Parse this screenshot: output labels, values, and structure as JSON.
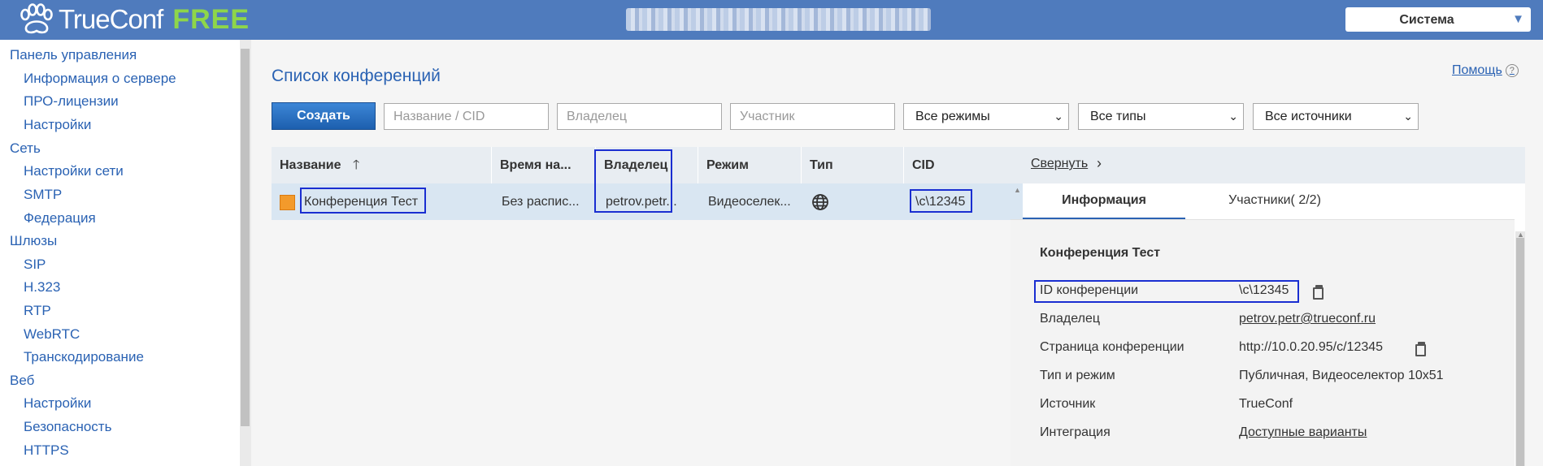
{
  "header": {
    "logo_text": "TrueConf",
    "logo_badge": "FREE",
    "system_select": "Система",
    "colors": {
      "bar": "#4f7bbd",
      "badge": "#8ed64a"
    }
  },
  "sidebar": {
    "items": [
      {
        "label": "Панель управления",
        "level": 0
      },
      {
        "label": "Информация о сервере",
        "level": 1
      },
      {
        "label": "ПРО-лицензии",
        "level": 1
      },
      {
        "label": "Настройки",
        "level": 1
      },
      {
        "label": "Сеть",
        "level": 0
      },
      {
        "label": "Настройки сети",
        "level": 1
      },
      {
        "label": "SMTP",
        "level": 1
      },
      {
        "label": "Федерация",
        "level": 1
      },
      {
        "label": "Шлюзы",
        "level": 0
      },
      {
        "label": "SIP",
        "level": 1
      },
      {
        "label": "H.323",
        "level": 1
      },
      {
        "label": "RTP",
        "level": 1
      },
      {
        "label": "WebRTC",
        "level": 1
      },
      {
        "label": "Транскодирование",
        "level": 1
      },
      {
        "label": "Веб",
        "level": 0
      },
      {
        "label": "Настройки",
        "level": 1
      },
      {
        "label": "Безопасность",
        "level": 1
      },
      {
        "label": "HTTPS",
        "level": 1
      }
    ]
  },
  "main": {
    "title": "Список конференций",
    "help": "Помощь",
    "help_icon": "question-circle-icon",
    "create_button": "Создать",
    "filters": {
      "name_placeholder": "Название / CID",
      "owner_placeholder": "Владелец",
      "participant_placeholder": "Участник",
      "modes": "Все режимы",
      "types": "Все типы",
      "sources": "Все источники"
    },
    "table": {
      "columns": [
        "Название",
        "Время на...",
        "Владелец",
        "Режим",
        "Тип",
        "CID"
      ],
      "sort_icon": "arrow-up-icon",
      "rows": [
        {
          "name": "Конференция Тест",
          "time": "Без распис...",
          "owner": "petrov.petr...",
          "mode": "Видеоселек...",
          "type_icon": "globe-icon",
          "cid": "\\c\\12345"
        }
      ]
    }
  },
  "panel": {
    "collapse": "Свернуть",
    "tabs": [
      "Информация",
      "Участники( 2/2)"
    ],
    "conf_name": "Конференция Тест",
    "fields": [
      {
        "label": "ID конференции",
        "value": "\\c\\12345"
      },
      {
        "label": "Владелец",
        "value": "petrov.petr@trueconf.ru"
      },
      {
        "label": "Страница конференции",
        "value": "http://10.0.20.95/c/12345"
      },
      {
        "label": "Тип и режим",
        "value": "Публичная, Видеоселектор 10x51"
      },
      {
        "label": "Источник",
        "value": "TrueConf"
      },
      {
        "label": "Интеграция",
        "value": "Доступные варианты"
      }
    ]
  }
}
